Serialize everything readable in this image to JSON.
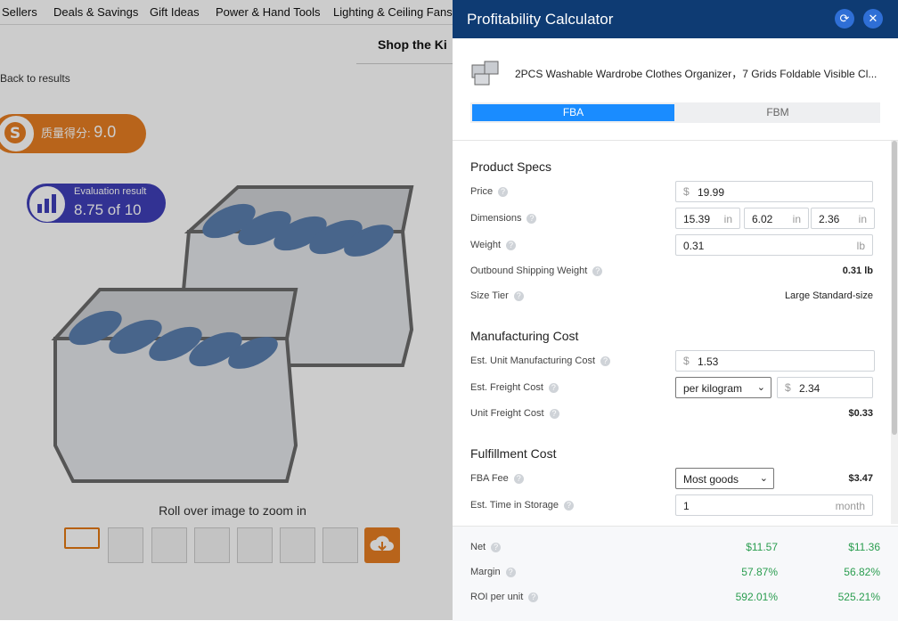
{
  "nav": {
    "items": [
      "Sellers",
      "Deals & Savings",
      "Gift Ideas",
      "Power & Hand Tools",
      "Lighting & Ceiling Fans"
    ]
  },
  "shop_heading": "Shop the Ki",
  "back_link": "Back to results",
  "score_badge": {
    "label": "质量得分:",
    "value": "9.0"
  },
  "evaluation": {
    "title": "Evaluation result",
    "value": "8.75 of 10"
  },
  "zoom_hint": "Roll over image to zoom in",
  "panel": {
    "title": "Profitability Calculator",
    "product_title": "2PCS Washable Wardrobe Clothes Organizer，7 Grids Foldable Visible Cl...",
    "tabs": {
      "fba": "FBA",
      "fbm": "FBM"
    },
    "product_specs": {
      "title": "Product Specs",
      "price_label": "Price",
      "price_prefix": "$",
      "price_value": "19.99",
      "dimensions_label": "Dimensions",
      "dim_l": "15.39",
      "dim_w": "6.02",
      "dim_h": "2.36",
      "dim_unit": "in",
      "weight_label": "Weight",
      "weight_value": "0.31",
      "weight_unit": "lb",
      "outbound_label": "Outbound Shipping Weight",
      "outbound_value": "0.31 lb",
      "size_tier_label": "Size Tier",
      "size_tier_value": "Large Standard-size"
    },
    "manufacturing": {
      "title": "Manufacturing Cost",
      "unit_cost_label": "Est. Unit Manufacturing Cost",
      "unit_cost_prefix": "$",
      "unit_cost_value": "1.53",
      "freight_label": "Est. Freight Cost",
      "freight_mode": "per kilogram",
      "freight_prefix": "$",
      "freight_value": "2.34",
      "unit_freight_label": "Unit Freight Cost",
      "unit_freight_value": "$0.33"
    },
    "fulfillment": {
      "title": "Fulfillment Cost",
      "fba_fee_label": "FBA Fee",
      "fba_fee_mode": "Most goods",
      "fba_fee_value": "$3.47",
      "storage_label": "Est. Time in Storage",
      "storage_value": "1",
      "storage_unit": "month"
    },
    "summary": {
      "net_label": "Net",
      "net_fba": "$11.57",
      "net_fbm": "$11.36",
      "margin_label": "Margin",
      "margin_fba": "57.87%",
      "margin_fbm": "56.82%",
      "roi_label": "ROI per unit",
      "roi_fba": "592.01%",
      "roi_fbm": "525.21%"
    }
  },
  "colors": {
    "header": "#0e3b73",
    "accent": "#1a8cff",
    "score_orange": "#e67e22",
    "eval_purple": "#3f3fb8",
    "positive": "#2a9d4f"
  }
}
